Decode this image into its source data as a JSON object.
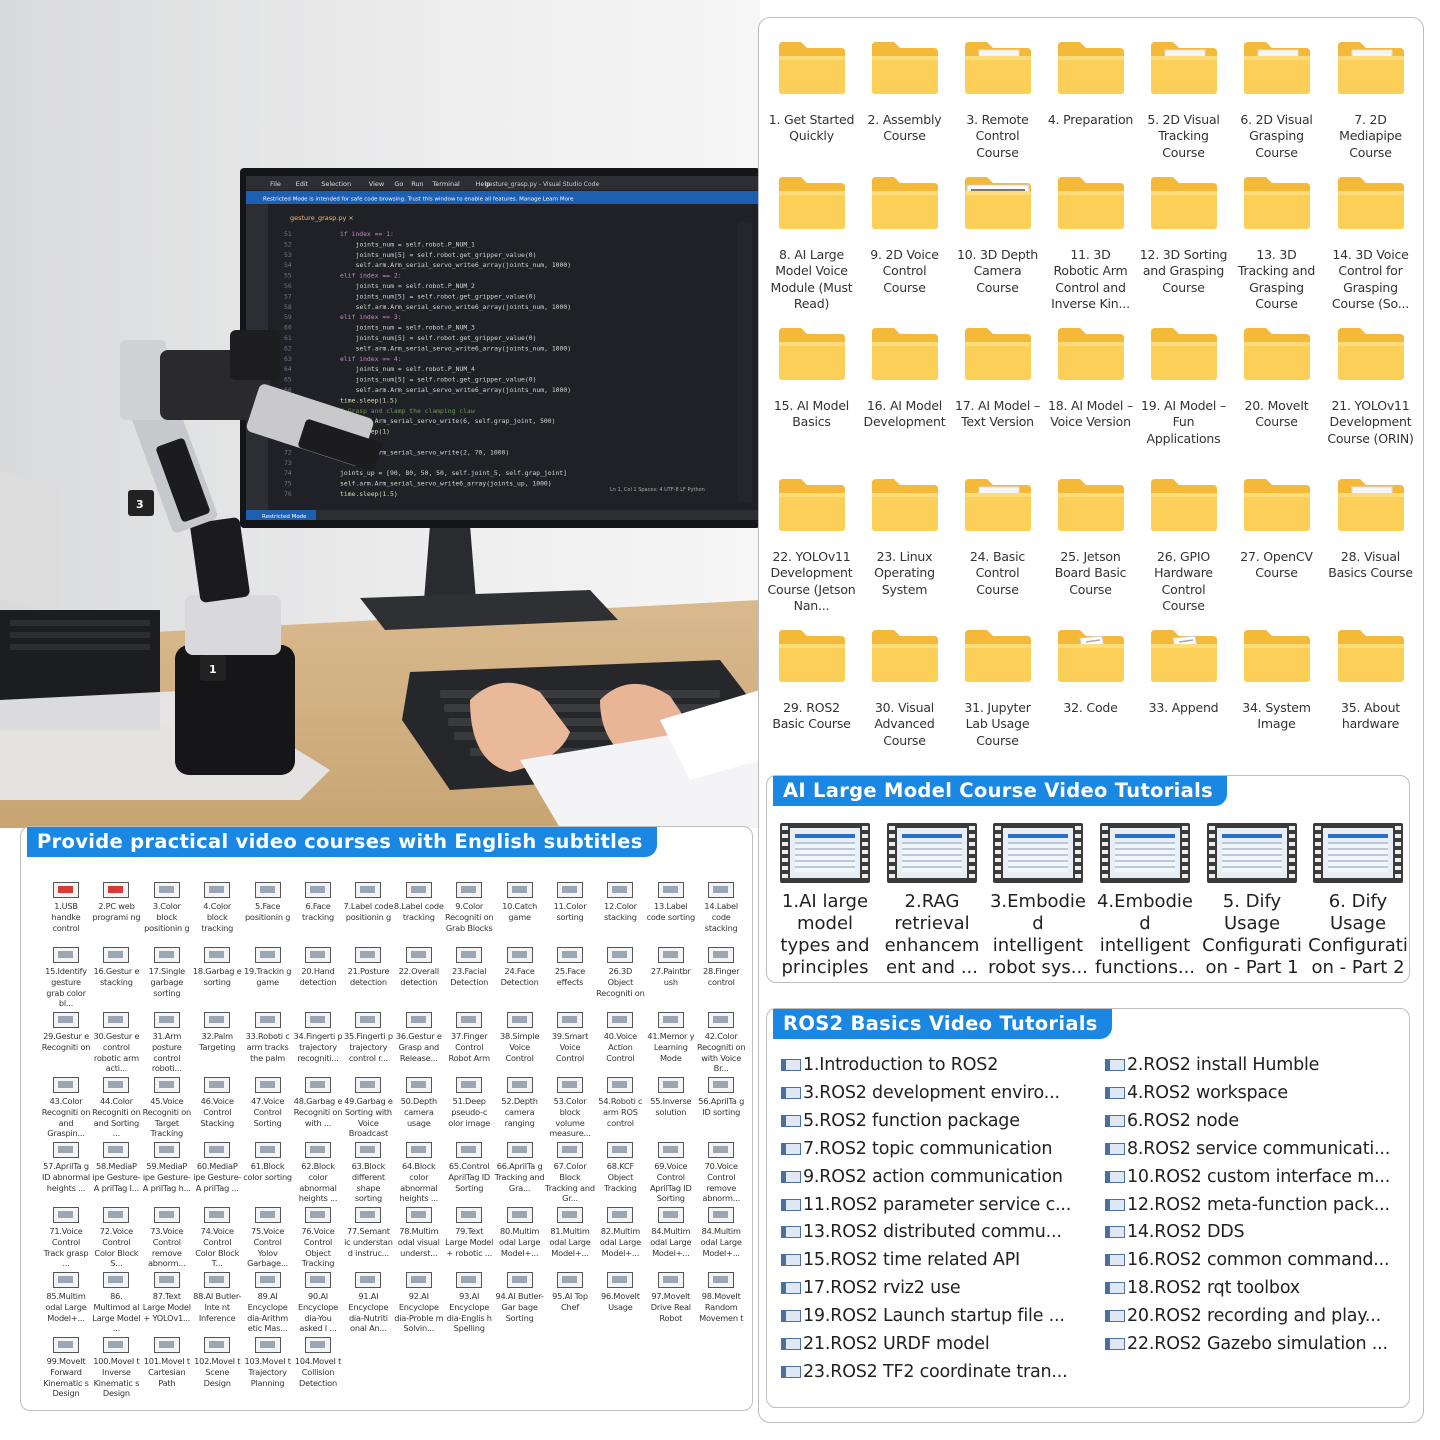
{
  "photo": {
    "editor_menu": [
      "File",
      "Edit",
      "Selection",
      "View",
      "Go",
      "Run",
      "Terminal",
      "Help"
    ],
    "editor_title": "gesture_grasp.py - Visual Studio Code",
    "restricted_notice": "Restricted Mode is intended for safe code browsing. Trust this window to enable all features.",
    "notice_links": [
      "Manage",
      "Learn More"
    ],
    "tab_name": "gesture_grasp.py",
    "status_left": "Restricted Mode",
    "status_right": "Ln 1, Col 1   Spaces: 4   UTF-8   LF   Python",
    "code_lines": [
      "if index == 1:",
      "    joints_num = self.robot.P_NUM_1",
      "    joints_num[5] = self.robot.get_gripper_value(0)",
      "    self.arm.Arm_serial_servo_write6_array(joints_num, 1000)",
      "elif index == 2:",
      "    joints_num = self.robot.P_NUM_2",
      "    joints_num[5] = self.robot.get_gripper_value(0)",
      "    self.arm.Arm_serial_servo_write6_array(joints_num, 1000)",
      "elif index == 3:",
      "    joints_num = self.robot.P_NUM_3",
      "    joints_num[5] = self.robot.get_gripper_value(0)",
      "    self.arm.Arm_serial_servo_write6_array(joints_num, 1000)",
      "elif index == 4:",
      "    joints_num = self.robot.P_NUM_4",
      "    joints_num[5] = self.robot.get_gripper_value(0)",
      "    self.arm.Arm_serial_servo_write6_array(joints_num, 1000)",
      "time.sleep(1.5)",
      "# Grasp and clamp the clamping claw",
      "self.arm.Arm_serial_servo_write(6, self.grap_joint, 500)",
      "time.sleep(1)",
      "# set up",
      "self.arm.Arm_serial_servo_write(2, 70, 1000)",
      "",
      "joints_up = [90, 80, 50, 50, self.joint_5, self.grap_joint]",
      "self.arm.Arm_serial_servo_write6_array(joints_up, 1000)",
      "time.sleep(1.5)"
    ],
    "line_numbers_start": 51
  },
  "folders": [
    {
      "label": "1. Get Started Quickly",
      "style": "plain"
    },
    {
      "label": "2. Assembly Course",
      "style": "plain"
    },
    {
      "label": "3. Remote Control Course",
      "style": "doc"
    },
    {
      "label": "4. Preparation",
      "style": "plain"
    },
    {
      "label": "5. 2D Visual Tracking Course",
      "style": "doc"
    },
    {
      "label": "6. 2D Visual Grasping Course",
      "style": "doc"
    },
    {
      "label": "7. 2D Mediapipe Course",
      "style": "doc"
    },
    {
      "label": "8. AI Large Model Voice Module (Must Read)",
      "style": "plain"
    },
    {
      "label": "9. 2D Voice Control Course",
      "style": "plain"
    },
    {
      "label": "10. 3D Depth Camera Course",
      "style": "open"
    },
    {
      "label": "11. 3D Robotic Arm Control and Inverse Kin...",
      "style": "plain"
    },
    {
      "label": "12. 3D Sorting and Grasping Course",
      "style": "plain"
    },
    {
      "label": "13. 3D Tracking and Grasping Course",
      "style": "plain"
    },
    {
      "label": "14. 3D Voice Control for Grasping Course (So...",
      "style": "plain"
    },
    {
      "label": "15. AI Model Basics",
      "style": "plain"
    },
    {
      "label": "16. AI Model Development",
      "style": "plain"
    },
    {
      "label": "17. AI Model – Text Version",
      "style": "plain"
    },
    {
      "label": "18. AI Model – Voice Version",
      "style": "plain"
    },
    {
      "label": "19. AI Model – Fun Applications",
      "style": "plain"
    },
    {
      "label": "20. MoveIt Course",
      "style": "plain"
    },
    {
      "label": "21. YOLOv11 Development Course (ORIN)",
      "style": "plain"
    },
    {
      "label": "22. YOLOv11 Development Course (Jetson Nan...",
      "style": "plain"
    },
    {
      "label": "23. Linux Operating System",
      "style": "plain"
    },
    {
      "label": "24. Basic Control Course",
      "style": "doc"
    },
    {
      "label": "25. Jetson Board Basic Course",
      "style": "plain"
    },
    {
      "label": "26. GPIO Hardware Control Course",
      "style": "plain"
    },
    {
      "label": "27. OpenCV Course",
      "style": "plain"
    },
    {
      "label": "28. Visual Basics Course",
      "style": "doc"
    },
    {
      "label": "29. ROS2 Basic Course",
      "style": "plain"
    },
    {
      "label": "30. Visual Advanced Course",
      "style": "plain"
    },
    {
      "label": "31. Jupyter Lab Usage Course",
      "style": "plain"
    },
    {
      "label": "32. Code",
      "style": "paper"
    },
    {
      "label": "33. Append",
      "style": "paper"
    },
    {
      "label": "34. System Image",
      "style": "plain"
    },
    {
      "label": "35. About hardware",
      "style": "plain"
    }
  ],
  "ai_videos": {
    "title": "AI Large Model Course Video Tutorials",
    "items": [
      "1.AI large model types and principles",
      "2.RAG retrieval enhancem ent and ...",
      "3.Embodie d intelligent robot sys...",
      "4.Embodie d intelligent functions...",
      "5. Dify Usage Configurati on - Part 1",
      "6. Dify Usage Configurati on - Part 2"
    ]
  },
  "ros2": {
    "title": "ROS2 Basics Video Tutorials",
    "left": [
      "1.Introduction to ROS2",
      "3.ROS2 development enviro...",
      "5.ROS2 function package",
      "7.ROS2 topic communication",
      "9.ROS2 action communication",
      "11.ROS2 parameter service c...",
      "13.ROS2 distributed commu...",
      "15.ROS2 time related API",
      "17.ROS2 rviz2 use",
      "19.ROS2 Launch startup file ...",
      "21.ROS2 URDF model",
      "23.ROS2 TF2 coordinate tran..."
    ],
    "right": [
      "2.ROS2 install Humble",
      "4.ROS2 workspace",
      "6.ROS2 node",
      "8.ROS2 service communicati...",
      "10.ROS2 custom interface m...",
      "12.ROS2 meta-function pack...",
      "14.ROS2 DDS",
      "16.ROS2 common command...",
      "18.ROS2 rqt toolbox",
      "20.ROS2 recording and play...",
      "22.ROS2 Gazebo simulation ..."
    ]
  },
  "practical": {
    "title": "Provide practical video courses with English subtitles",
    "items": [
      "1.USB handke control",
      "2.PC web programi ng",
      "3.Color block positionin g",
      "4.Color block tracking",
      "5.Face positionin g",
      "6.Face tracking",
      "7.Label code positionin g",
      "8.Label code tracking",
      "9.Color Recogniti on Grab Blocks",
      "10.Catch game",
      "11.Color sorting",
      "12.Color stacking",
      "13.Label code sorting",
      "14.Label code stacking",
      "15.Identify gesture grab color bl...",
      "16.Gestur e stacking",
      "17.Single garbage sorting",
      "18.Garbag e sorting",
      "19.Trackin g game",
      "20.Hand detection",
      "21.Posture detection",
      "22.Overall detection",
      "23.Facial Detection",
      "24.Face Detection",
      "25.Face effects",
      "26.3D Object Recogniti on",
      "27.Paintbr ush",
      "28.Finger control",
      "29.Gestur e Recogniti on",
      "30.Gestur e control robotic arm acti...",
      "31.Arm posture control roboti...",
      "32.Palm Targeting",
      "33.Roboti c arm tracks the palm",
      "34.Fingerti p trajectory recogniti...",
      "35.Fingerti p trajectory control r...",
      "36.Gestur e Grasp and Release...",
      "37.Finger Control Robot Arm",
      "38.Simple Voice Control",
      "39.Smart Voice Control",
      "40.Voice Action Control",
      "41.Memor y Learning Mode",
      "42.Color Recogniti on with Voice Br...",
      "43.Color Recogniti on and Graspin...",
      "44.Color Recogniti on and Sorting ...",
      "45.Voice Recogniti on Target Tracking",
      "46.Voice Control Stacking",
      "47.Voice Control Sorting",
      "48.Garbag e Recogniti on with ...",
      "49.Garbag e Sorting with Voice Broadcast",
      "50.Depth camera usage",
      "51.Deep pseudo-c olor image",
      "52.Depth camera ranging",
      "53.Color block volume measure...",
      "54.Roboti c arm ROS control",
      "55.Inverse solution",
      "56.AprilTa g ID sorting",
      "57.AprilTa g ID abnormal heights ...",
      "58.MediaP ipe Gesture-A prilTag I...",
      "59.MediaP ipe Gesture-A prilTag h...",
      "60.MediaP ipe Gesture-A prilTag ...",
      "61.Block color sorting",
      "62.Block color abnormal heights ...",
      "63.Block different shape sorting",
      "64.Block color abnormal heights ...",
      "65.Control AprilTag ID Sorting",
      "66.AprilTa g Tracking and Gra...",
      "67.Color Block Tracking and Gr...",
      "68.KCF Object Tracking",
      "69.Voice Control AprilTag ID Sorting",
      "70.Voice Control remove abnorm...",
      "71.Voice Control Track grasp ...",
      "72.Voice Control Color Block S...",
      "73.Voice Control remove abnorm...",
      "74.Voice Control Color Block T...",
      "75.Voice Control Yolov Garbage...",
      "76.Voice Control Object Tracking",
      "77.Semant ic understan d instruc...",
      "78.Multim odal visual underst...",
      "79.Text Large Model + robotic ...",
      "80.Multim odal Large Model+...",
      "81.Multim odal Large Model+...",
      "82.Multim odal Large Model+...",
      "84.Multim odal Large Model+...",
      "84.Multim odal Large Model+...",
      "85.Multim odal Large Model+...",
      "86. Multimod al Large Model ...",
      "87.Text Large Model + YOLOv1...",
      "88.AI Butler-Inte nt Inference",
      "89.AI Encyclope dia-Arithm etic Mas...",
      "90.AI Encyclope dia-You asked I ...",
      "91.AI Encyclope dia-Nutriti onal An...",
      "92.AI Encyclope dia-Proble m Solvin...",
      "93.AI Encyclope dia-Englis h Spelling",
      "94.AI Butler-Gar bage Sorting",
      "95.AI Top Chef",
      "96.MoveIt Usage",
      "97.MoveIt Drive Real Robot",
      "98.MoveIt Random Movemen t",
      "99.MoveIt Forward Kinematic s Design",
      "100.MoveI t Inverse Kinematic s Design",
      "101.MoveI t Cartesian Path",
      "102.MoveI t Scene Design",
      "103.MoveI t Trajectory Planning",
      "104.MoveI t Collision Detection"
    ]
  }
}
